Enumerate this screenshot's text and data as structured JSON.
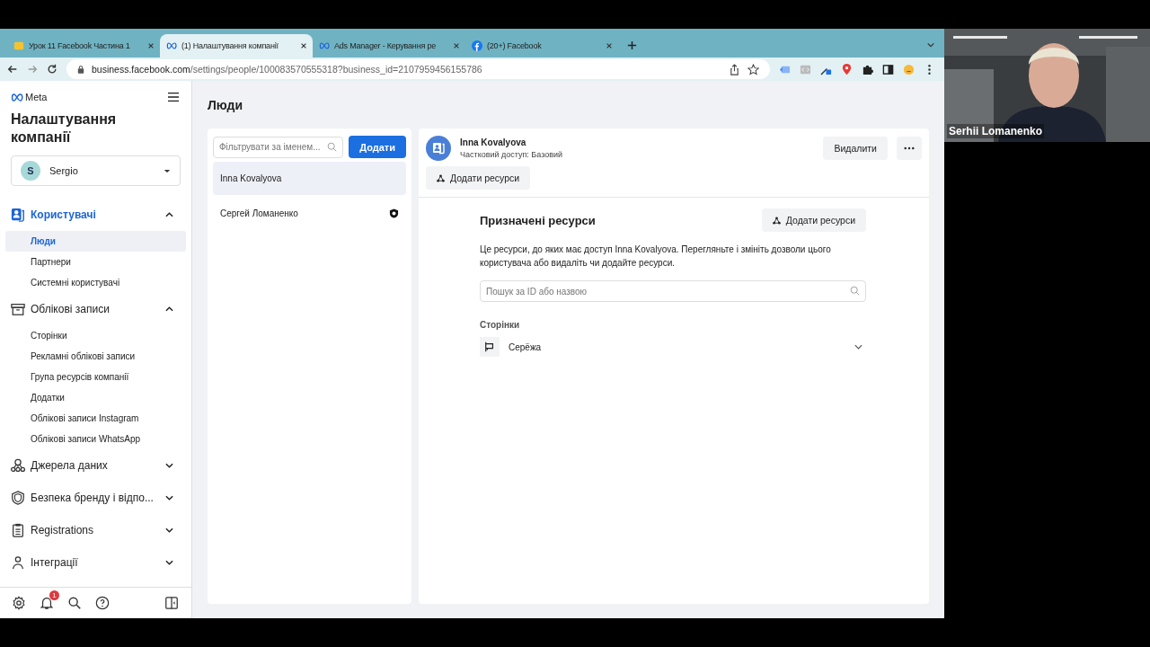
{
  "browser": {
    "tabs": [
      {
        "title": "Урок 11 Facebook Частина 1",
        "selected": false
      },
      {
        "title": "(1) Налаштування компанії",
        "selected": true
      },
      {
        "title": "Ads Manager - Керування ре",
        "selected": false
      },
      {
        "title": "(20+) Facebook",
        "selected": false
      }
    ],
    "url_host": "business.facebook.com",
    "url_path": "/settings/people/100083570555318?business_id=2107959456155786"
  },
  "sidebar": {
    "brand": "Meta",
    "title": "Налаштування компанії",
    "account": {
      "initial": "S",
      "name": "Sergio"
    },
    "sections": [
      {
        "label": "Користувачі",
        "selected": true,
        "expanded": true,
        "items": [
          {
            "label": "Люди",
            "selected": true
          },
          {
            "label": "Партнери",
            "selected": false
          },
          {
            "label": "Системні користувачі",
            "selected": false
          }
        ]
      },
      {
        "label": "Облікові записи",
        "selected": false,
        "expanded": true,
        "items": [
          {
            "label": "Сторінки",
            "selected": false
          },
          {
            "label": "Рекламні облікові записи",
            "selected": false
          },
          {
            "label": "Група ресурсів компанії",
            "selected": false
          },
          {
            "label": "Додатки",
            "selected": false
          },
          {
            "label": "Облікові записи Instagram",
            "selected": false
          },
          {
            "label": "Облікові записи WhatsApp",
            "selected": false
          }
        ]
      },
      {
        "label": "Джерела даних",
        "selected": false,
        "expanded": false
      },
      {
        "label": "Безпека бренду і відпо...",
        "selected": false,
        "expanded": false
      },
      {
        "label": "Registrations",
        "selected": false,
        "expanded": false
      },
      {
        "label": "Інтеграції",
        "selected": false,
        "expanded": false
      }
    ],
    "notification_count": "1"
  },
  "page_title": "Люди",
  "people_panel": {
    "filter_placeholder": "Фільтрувати за іменем...",
    "add_button": "Додати",
    "people": [
      {
        "name": "Inna Kovalyova",
        "selected": true,
        "admin": false
      },
      {
        "name": "Сергей Ломаненко",
        "selected": false,
        "admin": true
      }
    ]
  },
  "detail": {
    "name": "Inna Kovalyova",
    "access": "Частковий доступ: Базовий",
    "delete_button": "Видалити",
    "add_resources_button": "Додати ресурси",
    "assigned": {
      "title": "Призначені ресурси",
      "add_button": "Додати ресурси",
      "description": "Це ресурси, до яких має доступ Inna Kovalyova. Перегляньте і змініть дозволи цього користувача або видаліть чи додайте ресурси.",
      "search_placeholder": "Пошук за ID або назвою",
      "group_label": "Сторінки",
      "pages": [
        {
          "name": "Серёжа",
          "expanded": false
        }
      ]
    }
  },
  "video": {
    "participant": "Serhii Lomanenko"
  }
}
